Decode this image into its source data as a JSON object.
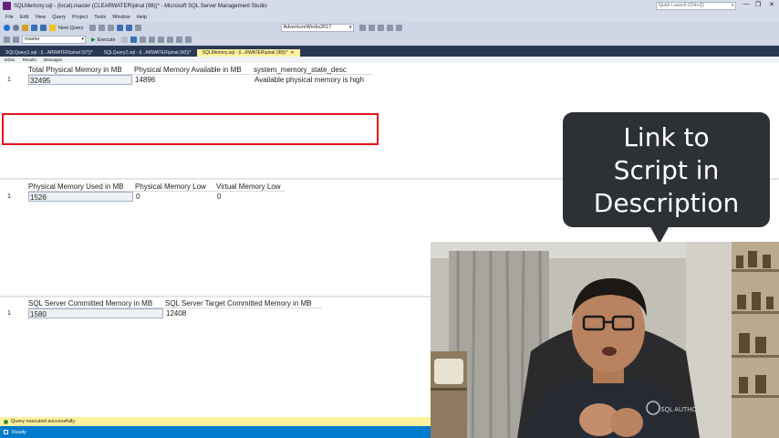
{
  "window": {
    "title": "SQLMemory.sql - (local).master (CLEARWATER\\pinal (98))* - Microsoft SQL Server Management Studio",
    "quick_launch_placeholder": "Quick Launch (Ctrl+Q)",
    "controls": [
      "—",
      "❐",
      "✕"
    ]
  },
  "menu": [
    "File",
    "Edit",
    "View",
    "Query",
    "Project",
    "Tools",
    "Window",
    "Help"
  ],
  "toolbar": {
    "new_query_label": "New Query",
    "database_combo": "AdventureWorks2017",
    "db_selector": "master",
    "execute_label": "Execute"
  },
  "doc_tabs": [
    {
      "label": "SQLQuery1.sql - (l...ARWATER\\pinal (97))*",
      "active": false
    },
    {
      "label": "SQLQuery2.sql - (l...ARWATER\\pinal (60))*",
      "active": false
    },
    {
      "label": "SQLMemory.sql - (l...RWATER\\pinal (98))*",
      "active": true
    }
  ],
  "result_tabs": [
    "Editor",
    "Results",
    "Messages"
  ],
  "grid1": {
    "columns": [
      "Total Physical Memory in MB",
      "Physical Memory Available in MB",
      "system_memory_state_desc"
    ],
    "row_number": "1",
    "row": [
      "32495",
      "14896",
      "Available physical memory is high"
    ]
  },
  "grid2": {
    "columns": [
      "Physical Memory Used in MB",
      "Physical Memory Low",
      "Virtual Memory Low"
    ],
    "row_number": "1",
    "row": [
      "1526",
      "0",
      "0"
    ]
  },
  "grid3": {
    "columns": [
      "SQL Server Committed Memory in MB",
      "SQL Server Target Committed Memory in MB"
    ],
    "row_number": "1",
    "row": [
      "1580",
      "12408"
    ]
  },
  "query_status": "Query executed successfully.",
  "app_status": "Ready",
  "callout": {
    "lines": [
      "Link to",
      "Script in",
      "Description"
    ]
  },
  "webcam": {
    "shirt_text": "SQL AUTHORITY"
  },
  "colors": {
    "highlight": "#e2141a",
    "status_yellow": "#fff29d",
    "status_blue": "#007acc",
    "callout_bg": "#2d3135"
  }
}
